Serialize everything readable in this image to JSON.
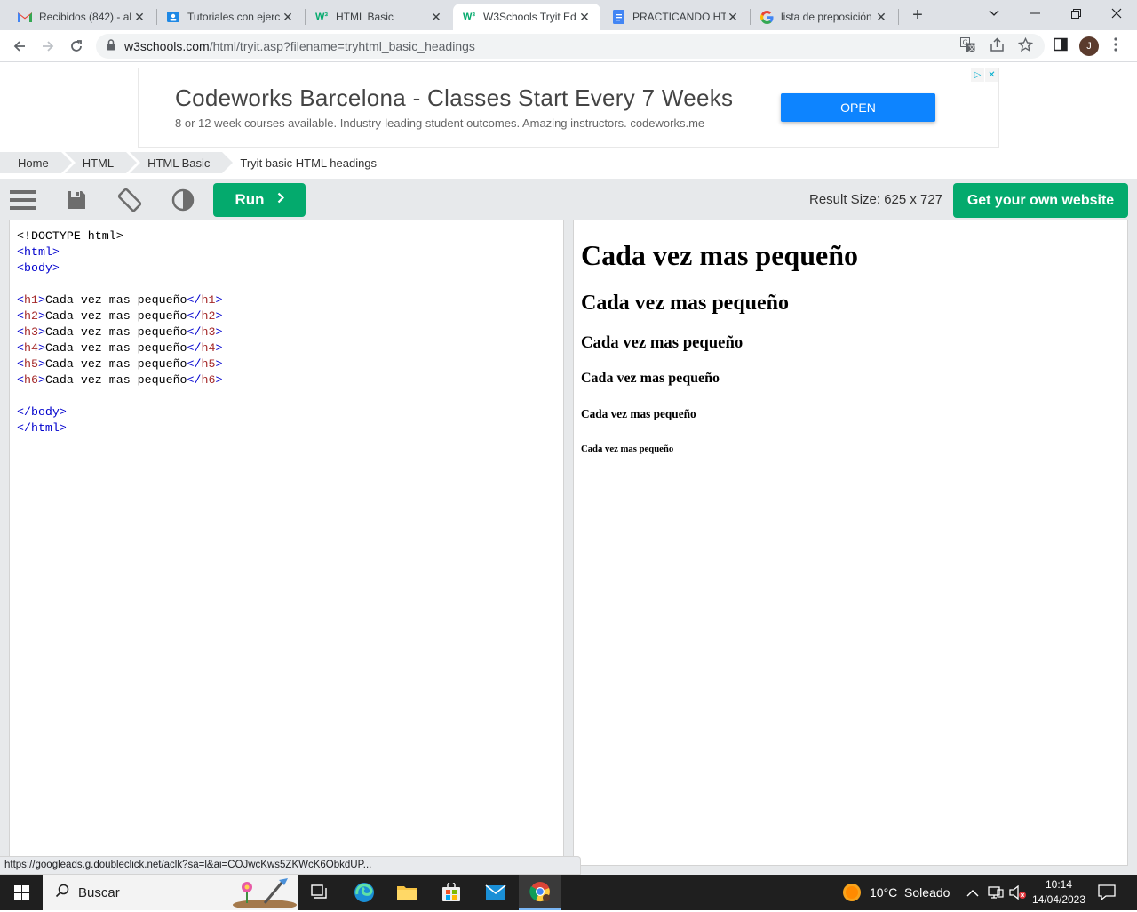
{
  "browser": {
    "tabs": [
      {
        "title": "Recibidos (842) - al",
        "favicon": "gmail-icon",
        "active": false
      },
      {
        "title": "Tutoriales con ejerc",
        "favicon": "classroom-icon",
        "active": false
      },
      {
        "title": "HTML Basic",
        "favicon": "w3schools-icon",
        "active": false
      },
      {
        "title": "W3Schools Tryit Ed",
        "favicon": "w3schools-icon",
        "active": true
      },
      {
        "title": "PRACTICANDO HTM",
        "favicon": "docs-icon",
        "active": false
      },
      {
        "title": "lista de preposición",
        "favicon": "google-icon",
        "active": false
      }
    ],
    "url_host": "w3schools.com",
    "url_path": "/html/tryit.asp?filename=tryhtml_basic_headings",
    "profile_initial": "J",
    "status_url": "https://googleads.g.doubleclick.net/aclk?sa=l&ai=COJwcKws5ZKWcK6ObkdUP..."
  },
  "ad": {
    "title": "Codeworks Barcelona - Classes Start Every 7 Weeks",
    "description": "8 or 12 week courses available. Industry-leading student outcomes. Amazing instructors. codeworks.me",
    "button": "OPEN"
  },
  "breadcrumb": [
    "Home",
    "HTML",
    "HTML Basic",
    "Tryit basic HTML headings"
  ],
  "toolbar": {
    "run_label": "Run",
    "result_size": "Result Size: 625 x 727",
    "own_site_label": "Get your own website"
  },
  "code": {
    "doctype": "<!DOCTYPE html>",
    "html_open": "<html>",
    "body_open": "<body>",
    "heading_text": "Cada vez mas pequeño",
    "body_close": "</body>",
    "html_close": "</html>"
  },
  "result": {
    "h1": "Cada vez mas pequeño",
    "h2": "Cada vez mas pequeño",
    "h3": "Cada vez mas pequeño",
    "h4": "Cada vez mas pequeño",
    "h5": "Cada vez mas pequeño",
    "h6": "Cada vez mas pequeño"
  },
  "taskbar": {
    "search_placeholder": "Buscar",
    "weather": "10°C  Soleado",
    "time": "10:14",
    "date": "14/04/2023"
  },
  "colors": {
    "w3_green": "#04aa6d",
    "ad_button": "#0d84ff",
    "code_tag": "#a52a2a",
    "code_bracket": "#0000cd"
  }
}
